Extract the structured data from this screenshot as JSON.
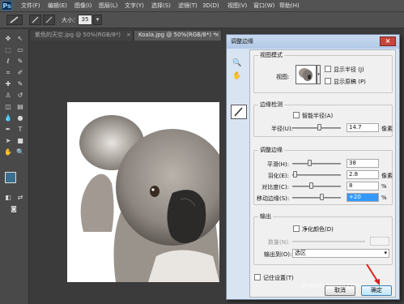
{
  "app": {
    "logo": "Ps"
  },
  "menubar": [
    "文件(F)",
    "编辑(E)",
    "图像(I)",
    "图层(L)",
    "文字(Y)",
    "选择(S)",
    "滤镜(T)",
    "3D(D)",
    "视图(V)",
    "窗口(W)",
    "帮助(H)"
  ],
  "options_bar": {
    "size_label": "大小：",
    "size_value": "35"
  },
  "tabs": [
    {
      "label": "紫色的天空.jpg @ 50%(RGB/8*)",
      "close": "×"
    },
    {
      "label": "Koala.jpg @ 50%(RGB/8*) *",
      "close": "×"
    }
  ],
  "dialog": {
    "title": "调整边缘",
    "close": "×",
    "view_mode": {
      "title": "视图模式",
      "view_label": "视图:",
      "show_radius": "显示半径 (J)",
      "show_original": "显示原稿 (P)"
    },
    "edge_detection": {
      "title": "边缘检测",
      "smart_radius": "智能半径(A)",
      "radius_label": "半径(U):",
      "radius_value": "14.7",
      "radius_unit": "像素"
    },
    "adjust_edge": {
      "title": "调整边缘",
      "rows": [
        {
          "label": "平滑(H):",
          "value": "38",
          "unit": "",
          "level": 0.35
        },
        {
          "label": "羽化(E):",
          "value": "2.8",
          "unit": "像素",
          "level": 0.05
        },
        {
          "label": "对比度(C):",
          "value": "8",
          "unit": "%",
          "level": 0.38
        },
        {
          "label": "移动边缘(S):",
          "value": "+20",
          "unit": "%",
          "level": 0.6
        }
      ]
    },
    "output": {
      "title": "输出",
      "decontaminate": "净化颜色(D)",
      "amount_label": "数量(N):",
      "output_to_label": "输出到(O):",
      "output_to_value": "选区"
    },
    "remember": "记住设置(T)",
    "cancel": "取消",
    "ok": "确定"
  },
  "watermark": "jingyan.baidu.com"
}
